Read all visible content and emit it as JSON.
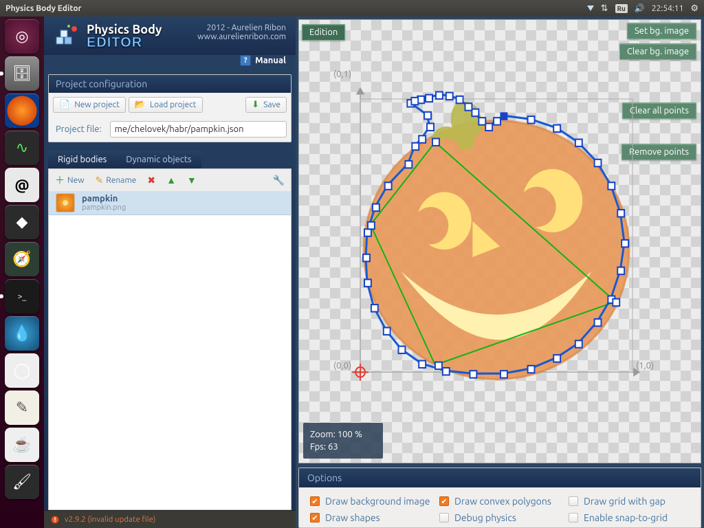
{
  "os": {
    "title": "Physics Body Editor",
    "lang_badge": "Ru",
    "clock": "22:54:11"
  },
  "launcher": {
    "items": [
      {
        "name": "dash",
        "glyph": "◌"
      },
      {
        "name": "files",
        "glyph": "🗂"
      },
      {
        "name": "firefox",
        "glyph": ""
      },
      {
        "name": "sysmon",
        "glyph": "∿"
      },
      {
        "name": "atril",
        "glyph": "a"
      },
      {
        "name": "inkscape",
        "glyph": "◆"
      },
      {
        "name": "android-studio",
        "glyph": "▲"
      },
      {
        "name": "terminal",
        "glyph": ">_"
      },
      {
        "name": "deluge",
        "glyph": "💧"
      },
      {
        "name": "chromium",
        "glyph": "◯"
      },
      {
        "name": "gedit",
        "glyph": "✎"
      },
      {
        "name": "java",
        "glyph": "☕"
      },
      {
        "name": "mypaint",
        "glyph": "🖌"
      }
    ]
  },
  "header": {
    "title_top": "Physics Body",
    "title_bottom": "EDITOR",
    "credit_line1": "2012 - Aurelien Ribon",
    "credit_line2": "www.aurelienribon.com",
    "manual": "Manual"
  },
  "project": {
    "panel_title": "Project configuration",
    "new_label": "New project",
    "load_label": "Load project",
    "save_label": "Save",
    "file_label": "Project file:",
    "file_value": "me/chelovek/habr/pampkin.json"
  },
  "tabs": {
    "rigid": "Rigid bodies",
    "dynamic": "Dynamic objects"
  },
  "toolbar": {
    "new": "New",
    "rename": "Rename"
  },
  "list": {
    "items": [
      {
        "name": "pampkin",
        "file": "pampkin.png"
      }
    ]
  },
  "status": {
    "text": "v2.9.2 (invalid update file)"
  },
  "canvas": {
    "edition": "Edition",
    "set_bg": "Set bg. image",
    "clear_bg": "Clear bg. image",
    "clear_points": "Clear all points",
    "remove_points": "Remove points",
    "zoom_label": "Zoom: 100 %",
    "fps_label": "Fps: 63",
    "axis00": "(0,0)",
    "axis01": "(0,1)",
    "axis10": "(1,0)"
  },
  "options": {
    "title": "Options",
    "draw_bg": "Draw background image",
    "draw_shapes": "Draw shapes",
    "draw_convex": "Draw convex polygons",
    "debug_physics": "Debug physics",
    "draw_grid": "Draw grid with gap",
    "snap": "Enable snap-to-grid"
  }
}
